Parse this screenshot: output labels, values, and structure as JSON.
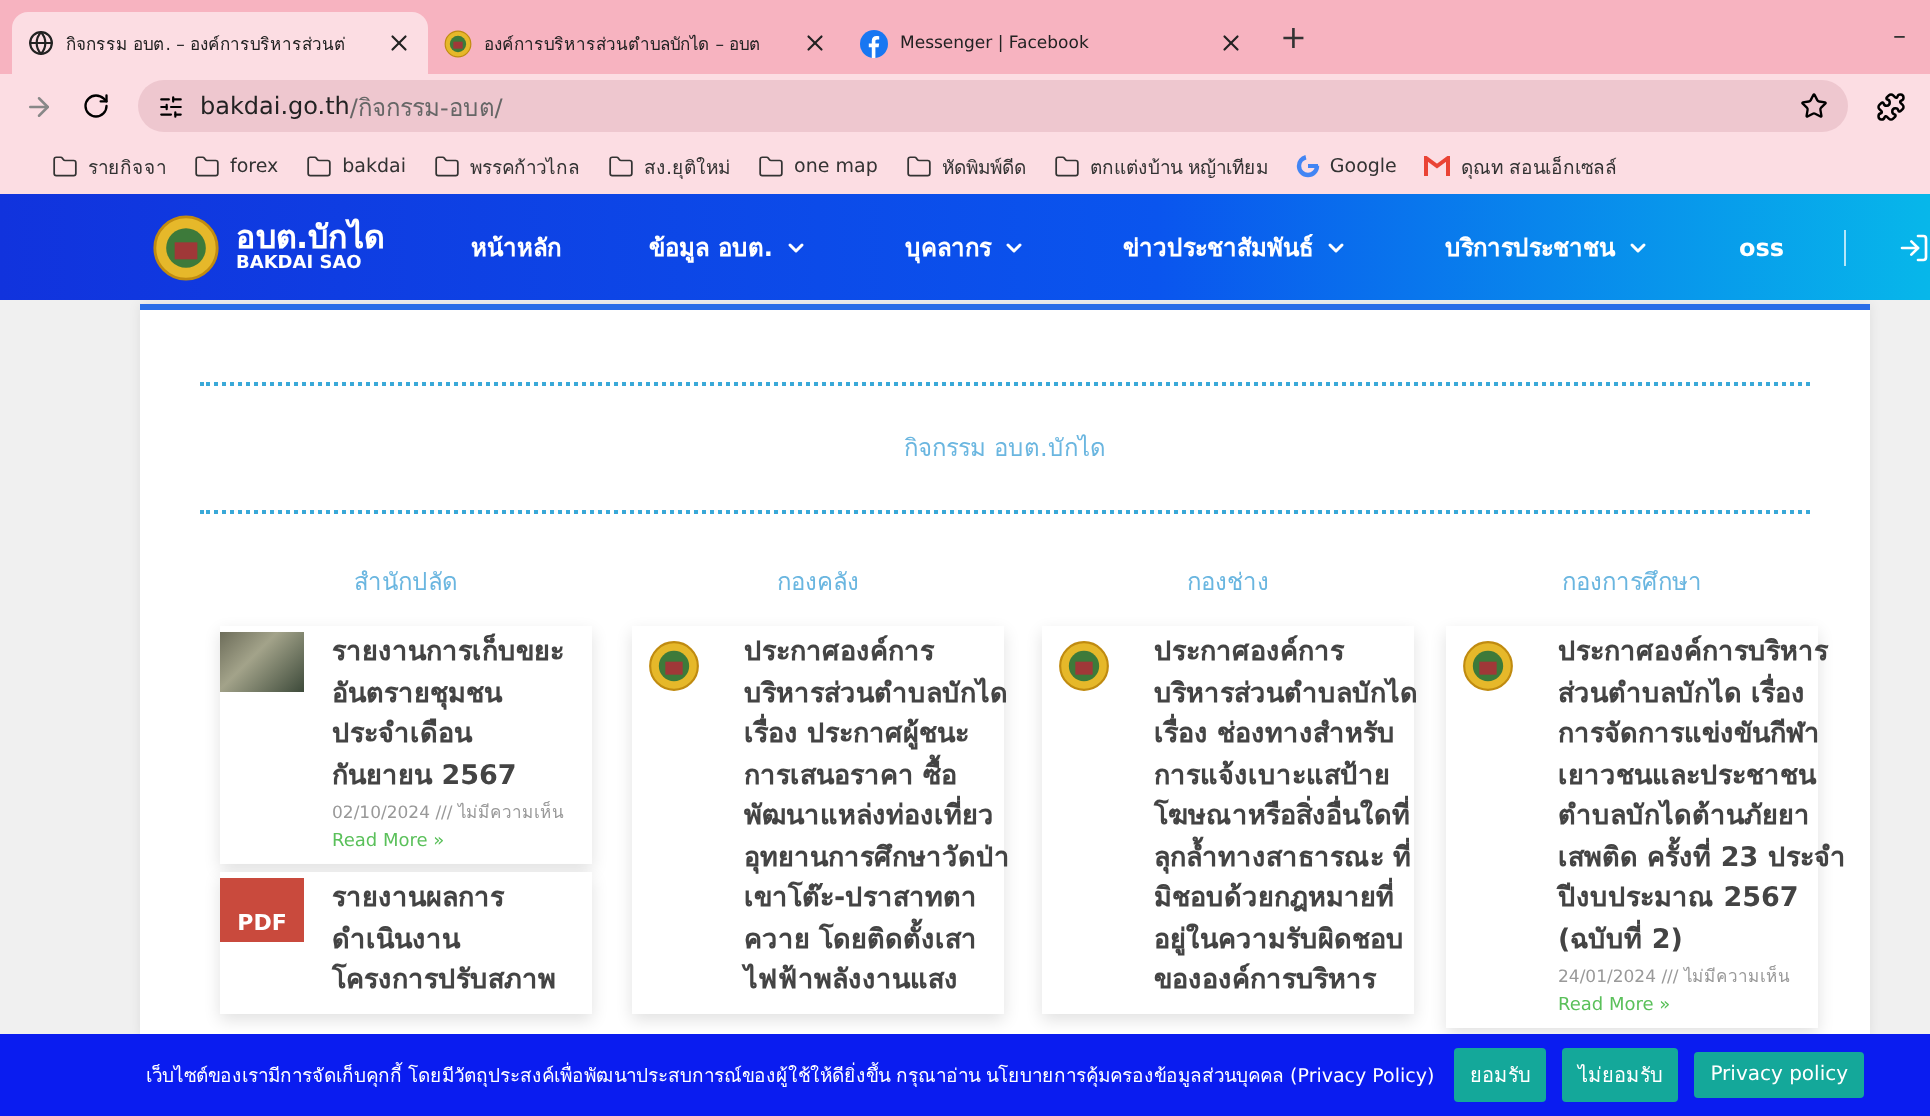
{
  "browser": {
    "tabs": [
      {
        "title": "กิจกรรม อบต. – องค์การบริหารส่วนต่",
        "kind": "globe",
        "selected": true
      },
      {
        "title": "องค์การบริหารส่วนตำบลบักได – อบต",
        "kind": "seal",
        "selected": false
      },
      {
        "title": "Messenger | Facebook",
        "kind": "facebook",
        "selected": false
      }
    ],
    "new_tab": "+",
    "minimize": "–",
    "address": {
      "domain": "bakdai.go.th",
      "path": "/กิจกรรม-อบต/"
    },
    "bookmarks": [
      {
        "label": "รายกิจจา",
        "kind": "folder"
      },
      {
        "label": "forex",
        "kind": "folder"
      },
      {
        "label": "bakdai",
        "kind": "folder"
      },
      {
        "label": "พรรคก้าวไกล",
        "kind": "folder"
      },
      {
        "label": "สง.ยุติใหม่",
        "kind": "folder"
      },
      {
        "label": "one map",
        "kind": "folder"
      },
      {
        "label": "หัดพิมพ์ดีด",
        "kind": "folder"
      },
      {
        "label": "ตกแต่งบ้าน หญ้าเทียม",
        "kind": "folder"
      },
      {
        "label": "Google",
        "kind": "google"
      },
      {
        "label": "ดุณท สอนเอ็กเซลล์",
        "kind": "gmail"
      }
    ]
  },
  "site": {
    "logo_title": "อบต.บักได",
    "logo_subtitle": "BAKDAI SAO",
    "nav": [
      {
        "label": "หน้าหลัก",
        "dropdown": false
      },
      {
        "label": "ข้อมูล อบต.",
        "dropdown": true
      },
      {
        "label": "บุคลากร",
        "dropdown": true
      },
      {
        "label": "ข่าวประชาสัมพันธ์",
        "dropdown": true
      },
      {
        "label": "บริการประชาชน",
        "dropdown": true
      },
      {
        "label": "oss",
        "dropdown": false
      }
    ]
  },
  "section_title": "กิจกรรม อบต.บักได",
  "columns": [
    {
      "heading": "สำนักปลัด",
      "posts": [
        {
          "thumb": {
            "kind": "photo"
          },
          "title": "รายงานการเก็บขยะ\nอันตรายชุมชน\nประจำเดือน\nกันยายน 2567",
          "meta": "02/10/2024 /// ไม่มีความเห็น",
          "read_more": "Read More »"
        },
        {
          "thumb": {
            "kind": "pdf",
            "label": "PDF"
          },
          "title": "รายงานผลการ\nดำเนินงาน\nโครงการปรับสภาพ"
        }
      ]
    },
    {
      "heading": "กองคลัง",
      "posts": [
        {
          "thumb": {
            "kind": "seal"
          },
          "title": "ประกาศองค์การ\nบริหารส่วนตำบลบักได\nเรื่อง ประกาศผู้ชนะ\nการเสนอราคา ซื้อ\nพัฒนาแหล่งท่องเที่ยว\nอุทยานการศึกษาวัดป่า\nเขาโต๊ะ-ปราสาทตา\nควาย โดยติดตั้งเสา\nไฟฟ้าพลังงานแสง"
        }
      ]
    },
    {
      "heading": "กองช่าง",
      "posts": [
        {
          "thumb": {
            "kind": "seal"
          },
          "title": "ประกาศองค์การ\nบริหารส่วนตำบลบักได\nเรื่อง ช่องทางสำหรับ\nการแจ้งเบาะแสป้าย\nโฆษณาหรือสิ่งอื่นใดที่\nลุกล้ำทางสาธารณะ ที่\nมิชอบด้วยกฎหมายที่\nอยู่ในความรับผิดชอบ\nขององค์การบริหาร"
        }
      ]
    },
    {
      "heading": "กองการศึกษา",
      "posts": [
        {
          "thumb": {
            "kind": "seal"
          },
          "title": "ประกาศองค์การบริหาร\nส่วนตำบลบักได เรื่อง\nการจัดการแข่งขันกีฬา\nเยาวชนและประชาชน\nตำบลบักไดต้านภัยยา\nเสพติด ครั้งที่ 23 ประจำ\nปีงบประมาณ 2567\n(ฉบับที่ 2)",
          "meta": "24/01/2024 /// ไม่มีความเห็น",
          "read_more": "Read More »"
        }
      ]
    }
  ],
  "cookie_bar": {
    "message": "เว็บไซต์ของเรามีการจัดเก็บคุกกี้ โดยมีวัตถุประสงค์เพื่อพัฒนาประสบการณ์ของผู้ใช้ให้ดียิ่งขึ้น กรุณาอ่าน นโยบายการคุ้มครองข้อมูลส่วนบุคคล (Privacy Policy)",
    "buttons": [
      "ยอมรับ",
      "ไม่ยอมรับ",
      "Privacy policy"
    ]
  }
}
